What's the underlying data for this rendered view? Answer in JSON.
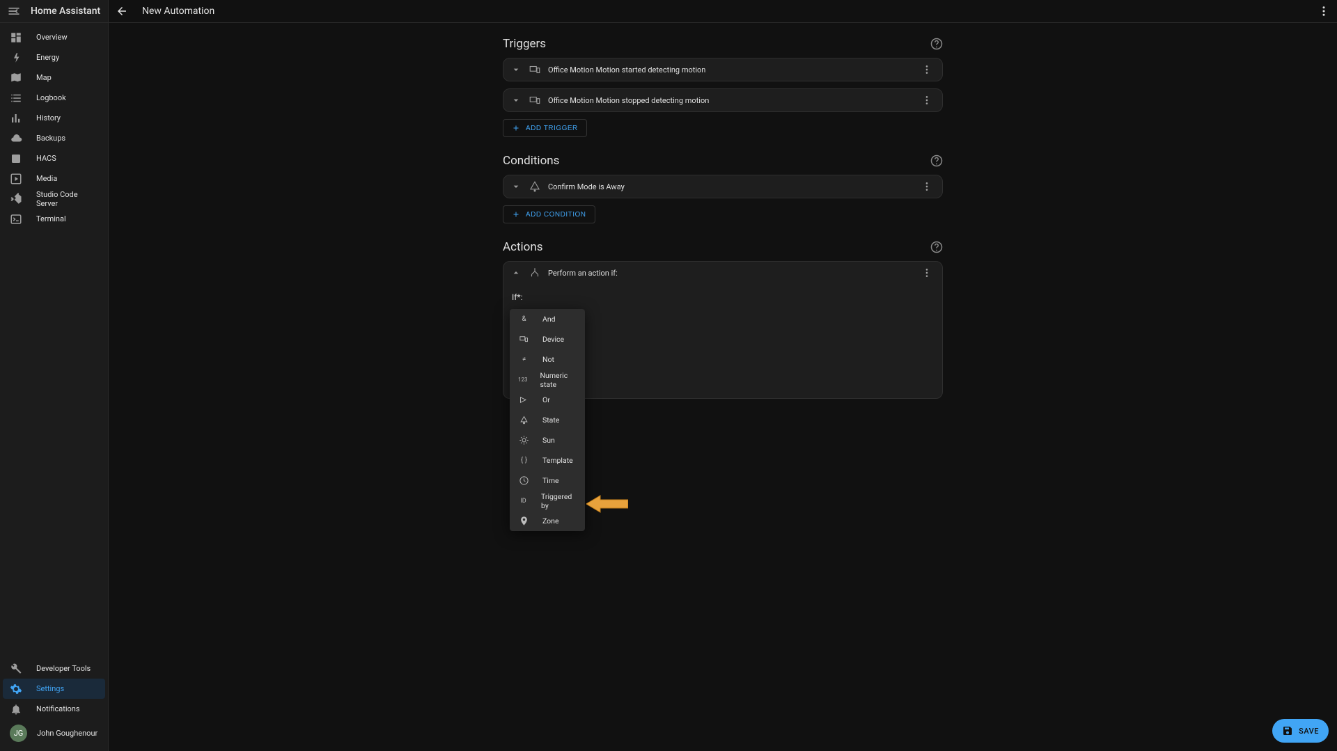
{
  "app_title": "Home Assistant",
  "page_title": "New Automation",
  "sidebar": {
    "items": [
      {
        "label": "Overview"
      },
      {
        "label": "Energy"
      },
      {
        "label": "Map"
      },
      {
        "label": "Logbook"
      },
      {
        "label": "History"
      },
      {
        "label": "Backups"
      },
      {
        "label": "HACS"
      },
      {
        "label": "Media"
      },
      {
        "label": "Studio Code Server"
      },
      {
        "label": "Terminal"
      }
    ],
    "bottom": {
      "dev_tools": "Developer Tools",
      "settings": "Settings",
      "notifications": "Notifications"
    },
    "user": {
      "initials": "JG",
      "name": "John Goughenour"
    }
  },
  "sections": {
    "triggers": {
      "title": "Triggers",
      "rows": [
        {
          "label": "Office Motion Motion started detecting motion"
        },
        {
          "label": "Office Motion Motion stopped detecting motion"
        }
      ],
      "add": "ADD TRIGGER"
    },
    "conditions": {
      "title": "Conditions",
      "rows": [
        {
          "label": "Confirm Mode is Away"
        }
      ],
      "add": "ADD CONDITION"
    },
    "actions": {
      "title": "Actions",
      "header_label": "Perform an action if:",
      "if_label": "If*:"
    }
  },
  "dropdown": {
    "items": [
      {
        "label": "And"
      },
      {
        "label": "Device"
      },
      {
        "label": "Not"
      },
      {
        "label": "Numeric state"
      },
      {
        "label": "Or"
      },
      {
        "label": "State"
      },
      {
        "label": "Sun"
      },
      {
        "label": "Template"
      },
      {
        "label": "Time"
      },
      {
        "label": "Triggered by"
      },
      {
        "label": "Zone"
      }
    ]
  },
  "save_label": "SAVE"
}
